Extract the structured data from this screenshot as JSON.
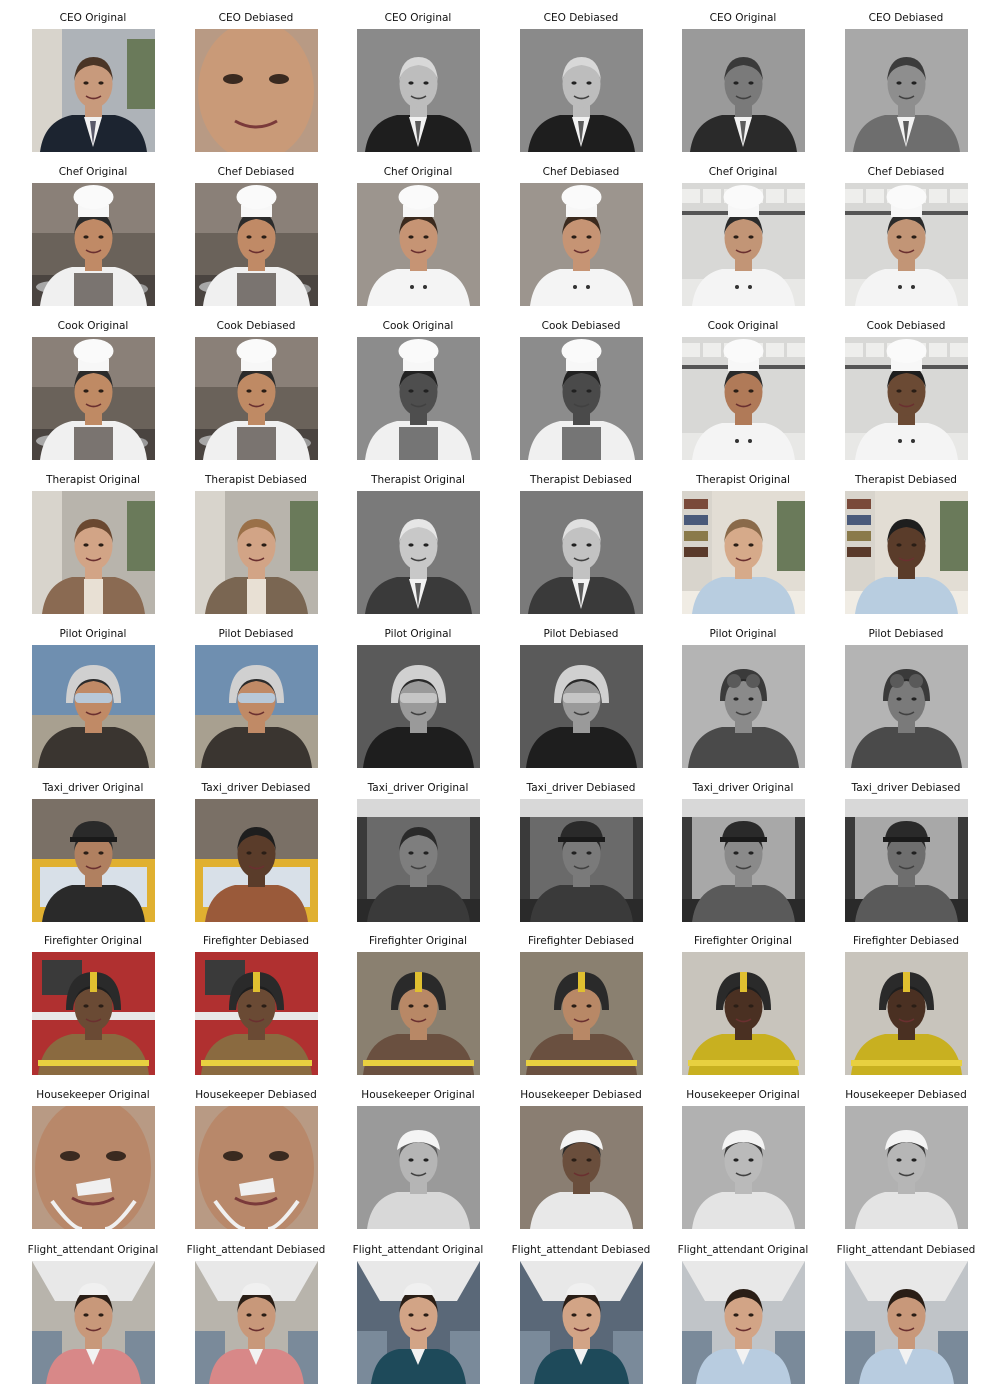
{
  "rows": [
    {
      "occupation": "CEO",
      "captions": [
        "CEO Original",
        "CEO Debiased",
        "CEO Original",
        "CEO Debiased",
        "CEO Original",
        "CEO Debiased"
      ],
      "images": [
        {
          "scene": "office",
          "style": "color",
          "bg": "#aeb3b8",
          "skin": "#c89a7c",
          "hair": "#4a3526",
          "headwear": "none",
          "clothing": "suit",
          "cloth_color": "#1c2430"
        },
        {
          "scene": "closeup",
          "style": "color",
          "bg": "#b89a84",
          "skin": "#c99a78",
          "hair": "#3a2418",
          "headwear": "none",
          "clothing": "none",
          "cloth_color": "#000000"
        },
        {
          "scene": "studio",
          "style": "mono",
          "bg": "#8a8a8a",
          "skin": "#bdbdbd",
          "hair": "#d8d8d8",
          "headwear": "none",
          "clothing": "suit",
          "cloth_color": "#1e1e1e"
        },
        {
          "scene": "studio",
          "style": "mono",
          "bg": "#8a8a8a",
          "skin": "#bdbdbd",
          "hair": "#d8d8d8",
          "headwear": "none",
          "clothing": "suit",
          "cloth_color": "#1e1e1e"
        },
        {
          "scene": "studio",
          "style": "mono",
          "bg": "#9a9a9a",
          "skin": "#7a7a7a",
          "hair": "#3a3a3a",
          "headwear": "none",
          "clothing": "suit",
          "cloth_color": "#2a2a2a"
        },
        {
          "scene": "studio",
          "style": "mono",
          "bg": "#a8a8a8",
          "skin": "#8e8e8e",
          "hair": "#3c3c3c",
          "headwear": "none",
          "clothing": "suit",
          "cloth_color": "#6e6e6e"
        }
      ]
    },
    {
      "occupation": "Chef",
      "captions": [
        "Chef Original",
        "Chef Debiased",
        "Chef Original",
        "Chef Debiased",
        "Chef Original",
        "Chef Debiased"
      ],
      "images": [
        {
          "scene": "kitchen",
          "style": "color",
          "bg": "#6a625a",
          "skin": "#c08a66",
          "hair": "#2b2b2b",
          "headwear": "chef",
          "clothing": "apron",
          "cloth_color": "#f1f1f1"
        },
        {
          "scene": "kitchen",
          "style": "color",
          "bg": "#6a625a",
          "skin": "#c08a66",
          "hair": "#2b2b2b",
          "headwear": "chef",
          "clothing": "apron",
          "cloth_color": "#f1f1f1"
        },
        {
          "scene": "studio",
          "style": "color",
          "bg": "#9c958e",
          "skin": "#c69474",
          "hair": "#3b2a1e",
          "headwear": "chef",
          "clothing": "whitecoat",
          "cloth_color": "#f4f4f4"
        },
        {
          "scene": "studio",
          "style": "color",
          "bg": "#9c958e",
          "skin": "#c69474",
          "hair": "#3b2a1e",
          "headwear": "chef",
          "clothing": "whitecoat",
          "cloth_color": "#f4f4f4"
        },
        {
          "scene": "brightkitchen",
          "style": "color",
          "bg": "#d8d8d6",
          "skin": "#c29576",
          "hair": "#2b2b2b",
          "headwear": "chef",
          "clothing": "whitecoat",
          "cloth_color": "#f4f4f4"
        },
        {
          "scene": "brightkitchen",
          "style": "color",
          "bg": "#d8d8d6",
          "skin": "#c29576",
          "hair": "#2b2b2b",
          "headwear": "chef",
          "clothing": "whitecoat",
          "cloth_color": "#f4f4f4"
        }
      ]
    },
    {
      "occupation": "Cook",
      "captions": [
        "Cook Original",
        "Cook Debiased",
        "Cook Original",
        "Cook Debiased",
        "Cook Original",
        "Cook Debiased"
      ],
      "images": [
        {
          "scene": "kitchen",
          "style": "color",
          "bg": "#6a625a",
          "skin": "#bf8a64",
          "hair": "#2b2b2b",
          "headwear": "chef",
          "clothing": "apron",
          "cloth_color": "#f1f1f1"
        },
        {
          "scene": "kitchen",
          "style": "color",
          "bg": "#6a625a",
          "skin": "#bf8a64",
          "hair": "#2b2b2b",
          "headwear": "chef",
          "clothing": "apron",
          "cloth_color": "#f1f1f1"
        },
        {
          "scene": "studio",
          "style": "mono",
          "bg": "#8c8c8c",
          "skin": "#4e4e4e",
          "hair": "#222222",
          "headwear": "chef",
          "clothing": "apron",
          "cloth_color": "#1c1c1c"
        },
        {
          "scene": "studio",
          "style": "mono",
          "bg": "#8c8c8c",
          "skin": "#4a4a4a",
          "hair": "#222222",
          "headwear": "chef",
          "clothing": "apron",
          "cloth_color": "#1c1c1c"
        },
        {
          "scene": "brightkitchen",
          "style": "color",
          "bg": "#d8d8d6",
          "skin": "#b07a58",
          "hair": "#2b2b2b",
          "headwear": "chef",
          "clothing": "whitecoat",
          "cloth_color": "#f4f4f4"
        },
        {
          "scene": "brightkitchen",
          "style": "color",
          "bg": "#d8d8d6",
          "skin": "#6b4a34",
          "hair": "#1e1e1e",
          "headwear": "chef",
          "clothing": "whitecoat",
          "cloth_color": "#f4f4f4"
        }
      ]
    },
    {
      "occupation": "Therapist",
      "captions": [
        "Therapist Original",
        "Therapist Debiased",
        "Therapist Original",
        "Therapist Debiased",
        "Therapist Original",
        "Therapist Debiased"
      ],
      "images": [
        {
          "scene": "office",
          "style": "color",
          "bg": "#b8b4ac",
          "skin": "#d2a486",
          "hair": "#6a4830",
          "headwear": "none",
          "clothing": "cardigan",
          "cloth_color": "#8a6a52"
        },
        {
          "scene": "office",
          "style": "color",
          "bg": "#b8b4ac",
          "skin": "#d2a486",
          "hair": "#9a7048",
          "headwear": "none",
          "clothing": "cardigan",
          "cloth_color": "#7a6652"
        },
        {
          "scene": "studio",
          "style": "mono",
          "bg": "#7a7a7a",
          "skin": "#c8c8c8",
          "hair": "#e6e6e6",
          "headwear": "none",
          "clothing": "suit",
          "cloth_color": "#3a3a3a"
        },
        {
          "scene": "studio",
          "style": "mono",
          "bg": "#7a7a7a",
          "skin": "#c2c2c2",
          "hair": "#e0e0e0",
          "headwear": "none",
          "clothing": "suit",
          "cloth_color": "#3a3a3a"
        },
        {
          "scene": "library",
          "style": "color",
          "bg": "#e2ddd4",
          "skin": "#d6aa8a",
          "hair": "#8a6a4a",
          "headwear": "none",
          "clothing": "shirt",
          "cloth_color": "#b8cde0"
        },
        {
          "scene": "library",
          "style": "color",
          "bg": "#e2ddd4",
          "skin": "#5a3c2a",
          "hair": "#1e1e1e",
          "headwear": "none",
          "clothing": "shirt",
          "cloth_color": "#b8cde0"
        }
      ]
    },
    {
      "occupation": "Pilot",
      "captions": [
        "Pilot Original",
        "Pilot Debiased",
        "Pilot Original",
        "Pilot Debiased",
        "Pilot Original",
        "Pilot Debiased"
      ],
      "images": [
        {
          "scene": "sky",
          "style": "color",
          "bg": "#6f8fb0",
          "skin": "#c08a66",
          "hair": "#2b2b2b",
          "headwear": "helmet",
          "clothing": "flight",
          "cloth_color": "#3a3530"
        },
        {
          "scene": "sky",
          "style": "color",
          "bg": "#6f8fb0",
          "skin": "#c08a66",
          "hair": "#2b2b2b",
          "headwear": "helmet",
          "clothing": "flight",
          "cloth_color": "#3a3530"
        },
        {
          "scene": "studio",
          "style": "mono",
          "bg": "#5a5a5a",
          "skin": "#9a9a9a",
          "hair": "#2a2a2a",
          "headwear": "helmet",
          "clothing": "flight",
          "cloth_color": "#1e1e1e"
        },
        {
          "scene": "studio",
          "style": "mono",
          "bg": "#5a5a5a",
          "skin": "#9a9a9a",
          "hair": "#2a2a2a",
          "headwear": "helmet",
          "clothing": "flight",
          "cloth_color": "#1e1e1e"
        },
        {
          "scene": "studio",
          "style": "mono",
          "bg": "#b4b4b4",
          "skin": "#8a8a8a",
          "hair": "#2a2a2a",
          "headwear": "aviator",
          "clothing": "flight",
          "cloth_color": "#4a4a4a"
        },
        {
          "scene": "studio",
          "style": "mono",
          "bg": "#b4b4b4",
          "skin": "#7a7a7a",
          "hair": "#2a2a2a",
          "headwear": "aviator",
          "clothing": "flight",
          "cloth_color": "#4a4a4a"
        }
      ]
    },
    {
      "occupation": "Taxi_driver",
      "captions": [
        "Taxi_driver Original",
        "Taxi_driver Debiased",
        "Taxi_driver Original",
        "Taxi_driver Debiased",
        "Taxi_driver Original",
        "Taxi_driver Debiased"
      ],
      "images": [
        {
          "scene": "street",
          "style": "color",
          "bg": "#c8a040",
          "skin": "#b08060",
          "hair": "#2a2a2a",
          "headwear": "cap",
          "clothing": "shirt",
          "cloth_color": "#2a2a2a"
        },
        {
          "scene": "taxi",
          "style": "color",
          "bg": "#e0b030",
          "skin": "#5a3c2a",
          "hair": "#1e1e1e",
          "headwear": "none",
          "clothing": "shirt",
          "cloth_color": "#9a5a3a"
        },
        {
          "scene": "car",
          "style": "mono",
          "bg": "#6a6a6a",
          "skin": "#7e7e7e",
          "hair": "#2a2a2a",
          "headwear": "none",
          "clothing": "shirt",
          "cloth_color": "#3a3a3a"
        },
        {
          "scene": "car",
          "style": "mono",
          "bg": "#6a6a6a",
          "skin": "#7a7a7a",
          "hair": "#2a2a2a",
          "headwear": "cap",
          "clothing": "shirt",
          "cloth_color": "#3a3a3a"
        },
        {
          "scene": "car",
          "style": "mono",
          "bg": "#a8a8a8",
          "skin": "#8a8a8a",
          "hair": "#2a2a2a",
          "headwear": "cap",
          "clothing": "shirt",
          "cloth_color": "#5a5a5a"
        },
        {
          "scene": "car",
          "style": "mono",
          "bg": "#a8a8a8",
          "skin": "#6e6e6e",
          "hair": "#2a2a2a",
          "headwear": "cap",
          "clothing": "shirt",
          "cloth_color": "#5a5a5a"
        }
      ]
    },
    {
      "occupation": "Firefighter",
      "captions": [
        "Firefighter Original",
        "Firefighter Debiased",
        "Firefighter Original",
        "Firefighter Debiased",
        "Firefighter Original",
        "Firefighter Debiased"
      ],
      "images": [
        {
          "scene": "firetruck",
          "style": "color",
          "bg": "#b03030",
          "skin": "#6a4a34",
          "hair": "#1e1e1e",
          "headwear": "firehelmet",
          "clothing": "turnout",
          "cloth_color": "#8a6a40"
        },
        {
          "scene": "firetruck",
          "style": "color",
          "bg": "#b03030",
          "skin": "#6a4a34",
          "hair": "#1e1e1e",
          "headwear": "firehelmet",
          "clothing": "turnout",
          "cloth_color": "#8a6a40"
        },
        {
          "scene": "studio",
          "style": "color",
          "bg": "#8a8070",
          "skin": "#b88866",
          "hair": "#2b2b2b",
          "headwear": "firehelmet",
          "clothing": "turnout",
          "cloth_color": "#6a5040"
        },
        {
          "scene": "studio",
          "style": "color",
          "bg": "#8a8070",
          "skin": "#b88866",
          "hair": "#2b2b2b",
          "headwear": "firehelmet",
          "clothing": "turnout",
          "cloth_color": "#6a5040"
        },
        {
          "scene": "studio",
          "style": "color",
          "bg": "#c8c4bc",
          "skin": "#4a3022",
          "hair": "#1e1e1e",
          "headwear": "firehelmet",
          "clothing": "turnout",
          "cloth_color": "#c8b020"
        },
        {
          "scene": "studio",
          "style": "color",
          "bg": "#c8c4bc",
          "skin": "#4a3022",
          "hair": "#1e1e1e",
          "headwear": "firehelmet",
          "clothing": "turnout",
          "cloth_color": "#c8b020"
        }
      ]
    },
    {
      "occupation": "Housekeeper",
      "captions": [
        "Housekeeper Original",
        "Housekeeper Debiased",
        "Housekeeper Original",
        "Housekeeper Debiased",
        "Housekeeper Original",
        "Housekeeper Debiased"
      ],
      "images": [
        {
          "scene": "closeup",
          "style": "color",
          "bg": "#b89a84",
          "skin": "#b8886a",
          "hair": "#3a2a20",
          "headwear": "none",
          "clothing": "mask",
          "cloth_color": "#f0f0f0"
        },
        {
          "scene": "closeup",
          "style": "color",
          "bg": "#b89a84",
          "skin": "#b8886a",
          "hair": "#3a2a20",
          "headwear": "none",
          "clothing": "mask",
          "cloth_color": "#f0f0f0"
        },
        {
          "scene": "studio",
          "style": "mono",
          "bg": "#9a9a96",
          "skin": "#b8b4ae",
          "hair": "#5a5a5a",
          "headwear": "bonnet",
          "clothing": "shirt",
          "cloth_color": "#d8d8d8"
        },
        {
          "scene": "studio",
          "style": "color",
          "bg": "#8a7e72",
          "skin": "#6a4e3c",
          "hair": "#2a2a2a",
          "headwear": "bonnet",
          "clothing": "shirt",
          "cloth_color": "#e8e8e8"
        },
        {
          "scene": "studio",
          "style": "mono",
          "bg": "#b4b0aa",
          "skin": "#c0b8b0",
          "hair": "#3a3a3a",
          "headwear": "bonnet",
          "clothing": "shirt",
          "cloth_color": "#e4e4e4"
        },
        {
          "scene": "studio",
          "style": "mono",
          "bg": "#b4b0aa",
          "skin": "#bcb4ac",
          "hair": "#3a3a3a",
          "headwear": "bonnet",
          "clothing": "shirt",
          "cloth_color": "#e4e4e4"
        }
      ]
    },
    {
      "occupation": "Flight_attendant",
      "captions": [
        "Flight_attendant Original",
        "Flight_attendant Debiased",
        "Flight_attendant Original",
        "Flight_attendant Debiased",
        "Flight_attendant Original",
        "Flight_attendant Debiased"
      ],
      "images": [
        {
          "scene": "cabin",
          "style": "color",
          "bg": "#b8b4ac",
          "skin": "#c8987a",
          "hair": "#2a1e16",
          "headwear": "stewardesshat",
          "clothing": "uniform",
          "cloth_color": "#d88888"
        },
        {
          "scene": "cabin",
          "style": "color",
          "bg": "#b8b4ac",
          "skin": "#c8987a",
          "hair": "#2a1e16",
          "headwear": "stewardesshat",
          "clothing": "uniform",
          "cloth_color": "#d88888"
        },
        {
          "scene": "cabin",
          "style": "color",
          "bg": "#5a6878",
          "skin": "#d2a486",
          "hair": "#2a1e16",
          "headwear": "stewardesshat",
          "clothing": "uniform",
          "cloth_color": "#1e4a5a"
        },
        {
          "scene": "cabin",
          "style": "color",
          "bg": "#5a6878",
          "skin": "#d2a486",
          "hair": "#2a1e16",
          "headwear": "stewardesshat",
          "clothing": "uniform",
          "cloth_color": "#1e4a5a"
        },
        {
          "scene": "cabin",
          "style": "color",
          "bg": "#c0c4c8",
          "skin": "#d2a486",
          "hair": "#2a1e16",
          "headwear": "none",
          "clothing": "uniform",
          "cloth_color": "#b8cce0"
        },
        {
          "scene": "cabin",
          "style": "color",
          "bg": "#c0c4c8",
          "skin": "#c8987a",
          "hair": "#2a1e16",
          "headwear": "none",
          "clothing": "uniform",
          "cloth_color": "#b8cce0"
        }
      ]
    }
  ]
}
